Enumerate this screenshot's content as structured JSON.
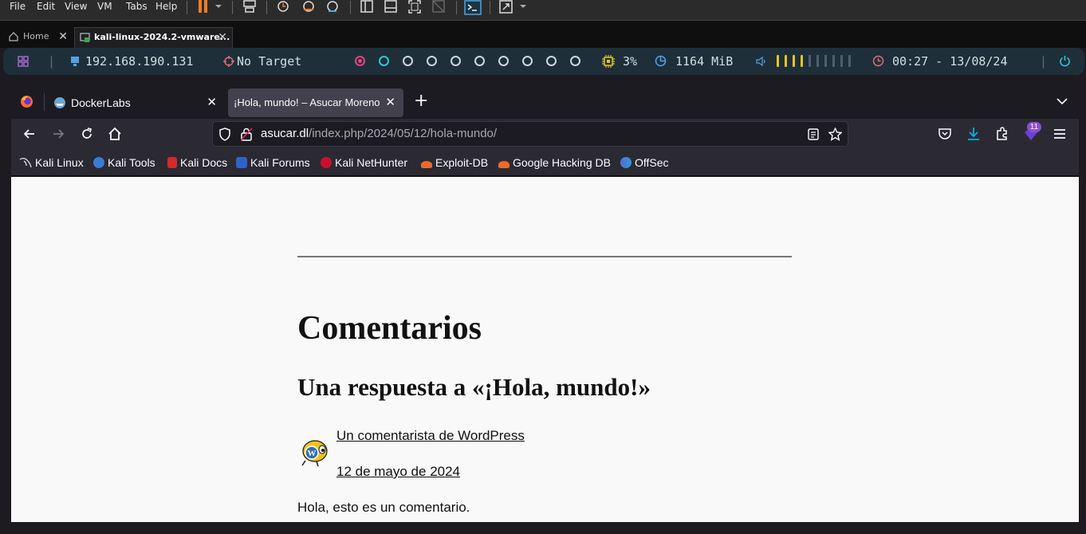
{
  "vm": {
    "menu": [
      "File",
      "Edit",
      "View",
      "VM",
      "Tabs",
      "Help"
    ],
    "tabs": [
      {
        "label": "Home",
        "icon": "home-icon"
      },
      {
        "label": "kali-linux-2024.2-vmware...",
        "icon": "vm-icon"
      }
    ]
  },
  "panel": {
    "ip": "192.168.190.131",
    "target": "No Target",
    "cpu": "3%",
    "memory": "1164 MiB",
    "clock": "00:27 - 13/08/24",
    "colors": {
      "panel_bg": "#1e2f3a",
      "cpu": "#e6c229",
      "memory": "#4ea3e6",
      "clock": "#e06c75",
      "workspace_active": "#e0457b",
      "workspace_second": "#35c2d8",
      "volume_on": "#e6c229",
      "volume_off": "#4a6070"
    },
    "volume_level": 0.4
  },
  "browser": {
    "tabs": [
      {
        "label": "DockerLabs",
        "active": false
      },
      {
        "label": "¡Hola, mundo! – Asucar Moreno",
        "active": true
      }
    ],
    "url_host": "asucar.dl",
    "url_path": "/index.php/2024/05/12/hola-mundo/",
    "extension_badge": "11",
    "bookmarks": [
      {
        "label": "Kali Linux",
        "icon": "kali-dragon-icon",
        "color": "#cfd6dc"
      },
      {
        "label": "Kali Tools",
        "icon": "kali-tools-icon",
        "color": "#3a7bd5"
      },
      {
        "label": "Kali Docs",
        "icon": "kali-docs-icon",
        "color": "#d42a2a"
      },
      {
        "label": "Kali Forums",
        "icon": "kali-forums-icon",
        "color": "#2d63c8"
      },
      {
        "label": "Kali NetHunter",
        "icon": "kali-nethunter-icon",
        "color": "#c8102e"
      },
      {
        "label": "Exploit-DB",
        "icon": "exploit-db-icon",
        "color": "#ec6a2b"
      },
      {
        "label": "Google Hacking DB",
        "icon": "ghdb-icon",
        "color": "#ec6a2b"
      },
      {
        "label": "OffSec",
        "icon": "offsec-icon",
        "color": "#5b6bd8"
      }
    ]
  },
  "page": {
    "comments_title": "Comentarios",
    "reply_title": "Una respuesta a «¡Hola, mundo!»",
    "author": "Un comentarista de WordPress",
    "date": "12 de mayo de 2024",
    "comment": "Hola, esto es un comentario."
  }
}
